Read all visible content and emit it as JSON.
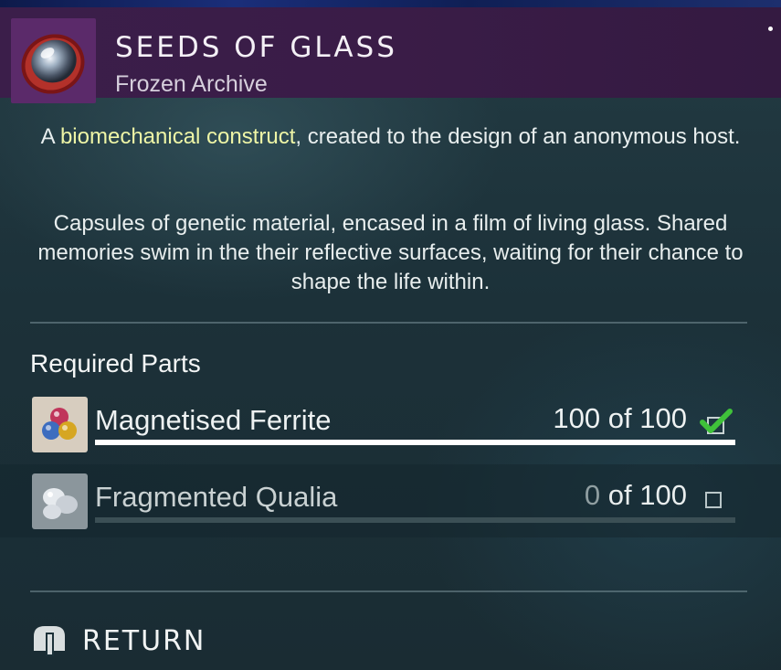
{
  "item": {
    "title": "SEEDS OF GLASS",
    "subtitle": "Frozen Archive",
    "icon": "glass-seed-icon"
  },
  "description": {
    "line1_prefix": "A ",
    "line1_highlight": "biomechanical construct",
    "line1_suffix": ", created to the design of an anonymous host.",
    "paragraph2": "Capsules of genetic material, encased in a film of living glass. Shared memories swim in the their reflective surfaces, waiting for their chance to shape the life within."
  },
  "required_parts": {
    "heading": "Required Parts",
    "items": [
      {
        "name": "Magnetised Ferrite",
        "have": "100",
        "of_label": "of",
        "need": "100",
        "progress": 1.0,
        "complete": true,
        "icon": "ferrite-icon"
      },
      {
        "name": "Fragmented Qualia",
        "have": "0",
        "of_label": "of",
        "need": "100",
        "progress": 0.0,
        "complete": false,
        "icon": "qualia-icon"
      }
    ]
  },
  "footer": {
    "return_label": "RETURN",
    "icon": "return-button-icon"
  },
  "colors": {
    "header_bg": "#3b1e4a",
    "highlight": "#eef5a6",
    "check_green": "#3fc23a",
    "panel_bg": "#1c3139"
  }
}
